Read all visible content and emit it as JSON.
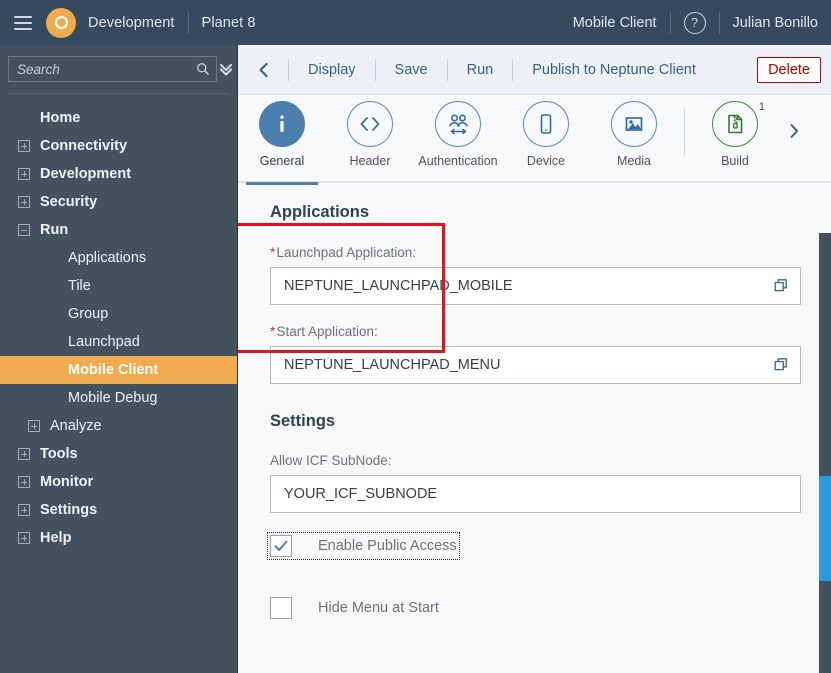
{
  "topbar": {
    "menu_icon": "hamburger-icon",
    "logo_icon": "planet-logo-icon",
    "brand": "Development",
    "system": "Planet 8",
    "app_name": "Mobile Client",
    "help_icon": "question-mark-icon",
    "help_label": "?",
    "user": "Julian Bonillo"
  },
  "sidebar": {
    "search": {
      "placeholder": "Search",
      "value": "",
      "icon": "search-icon"
    },
    "collapse_all_icon": "double-chevron-down-icon",
    "expand_all_icon": "double-chevron-up-icon",
    "items": [
      {
        "label": "Home",
        "level": 0,
        "expander": "none",
        "selected": false,
        "bold": true
      },
      {
        "label": "Connectivity",
        "level": 0,
        "expander": "plus",
        "selected": false,
        "bold": true
      },
      {
        "label": "Development",
        "level": 0,
        "expander": "plus",
        "selected": false,
        "bold": true
      },
      {
        "label": "Security",
        "level": 0,
        "expander": "plus",
        "selected": false,
        "bold": true
      },
      {
        "label": "Run",
        "level": 0,
        "expander": "minus",
        "selected": false,
        "bold": true
      },
      {
        "label": "Applications",
        "level": 1,
        "expander": "none",
        "selected": false,
        "bold": false
      },
      {
        "label": "Tile",
        "level": 1,
        "expander": "none",
        "selected": false,
        "bold": false
      },
      {
        "label": "Group",
        "level": 1,
        "expander": "none",
        "selected": false,
        "bold": false
      },
      {
        "label": "Launchpad",
        "level": 1,
        "expander": "none",
        "selected": false,
        "bold": false
      },
      {
        "label": "Mobile Client",
        "level": 1,
        "expander": "none",
        "selected": true,
        "bold": true
      },
      {
        "label": "Mobile Debug",
        "level": 1,
        "expander": "none",
        "selected": false,
        "bold": false
      },
      {
        "label": "Analyze",
        "level": 2,
        "expander": "plus",
        "selected": false,
        "bold": false
      },
      {
        "label": "Tools",
        "level": 0,
        "expander": "plus",
        "selected": false,
        "bold": true
      },
      {
        "label": "Monitor",
        "level": 0,
        "expander": "plus",
        "selected": false,
        "bold": true
      },
      {
        "label": "Settings",
        "level": 0,
        "expander": "plus",
        "selected": false,
        "bold": true
      },
      {
        "label": "Help",
        "level": 0,
        "expander": "plus",
        "selected": false,
        "bold": true
      }
    ]
  },
  "action_bar": {
    "back_icon": "chevron-left-icon",
    "links": [
      "Display",
      "Save",
      "Run",
      "Publish to Neptune Client"
    ],
    "delete_label": "Delete"
  },
  "tabs": {
    "next_icon": "chevron-right-icon",
    "items": [
      {
        "label": "General",
        "icon": "info-icon",
        "active": true,
        "badge": "",
        "style": "blue"
      },
      {
        "label": "Header",
        "icon": "code-brackets-icon",
        "active": false,
        "badge": "",
        "style": "blue"
      },
      {
        "label": "Authentication",
        "icon": "users-icon",
        "active": false,
        "badge": "",
        "style": "blue"
      },
      {
        "label": "Device",
        "icon": "mobile-phone-icon",
        "active": false,
        "badge": "",
        "style": "blue"
      },
      {
        "label": "Media",
        "icon": "image-icon",
        "active": false,
        "badge": "",
        "style": "blue"
      },
      {
        "label": "Build",
        "icon": "zip-archive-icon",
        "active": false,
        "badge": "1",
        "style": "green"
      }
    ]
  },
  "form": {
    "applications_title": "Applications",
    "launchpad_label": "Launchpad Application:",
    "launchpad_value": "NEPTUNE_LAUNCHPAD_MOBILE",
    "launchpad_help_icon": "value-help-icon",
    "start_label": "Start Application:",
    "start_value": "NEPTUNE_LAUNCHPAD_MENU",
    "start_help_icon": "value-help-icon",
    "required_marker": "*",
    "settings_title": "Settings",
    "icf_label": "Allow ICF SubNode:",
    "icf_value": "YOUR_ICF_SUBNODE",
    "public_access_label": "Enable Public Access",
    "public_access_checked": true,
    "check_icon": "checkmark-icon",
    "hide_menu_label": "Hide Menu at Start",
    "hide_menu_checked": false
  },
  "annotation": {
    "highlight_color": "#e8101a"
  },
  "scrollbar": {
    "track_color": "#44515f",
    "thumb_color": "#2b9ae0"
  }
}
